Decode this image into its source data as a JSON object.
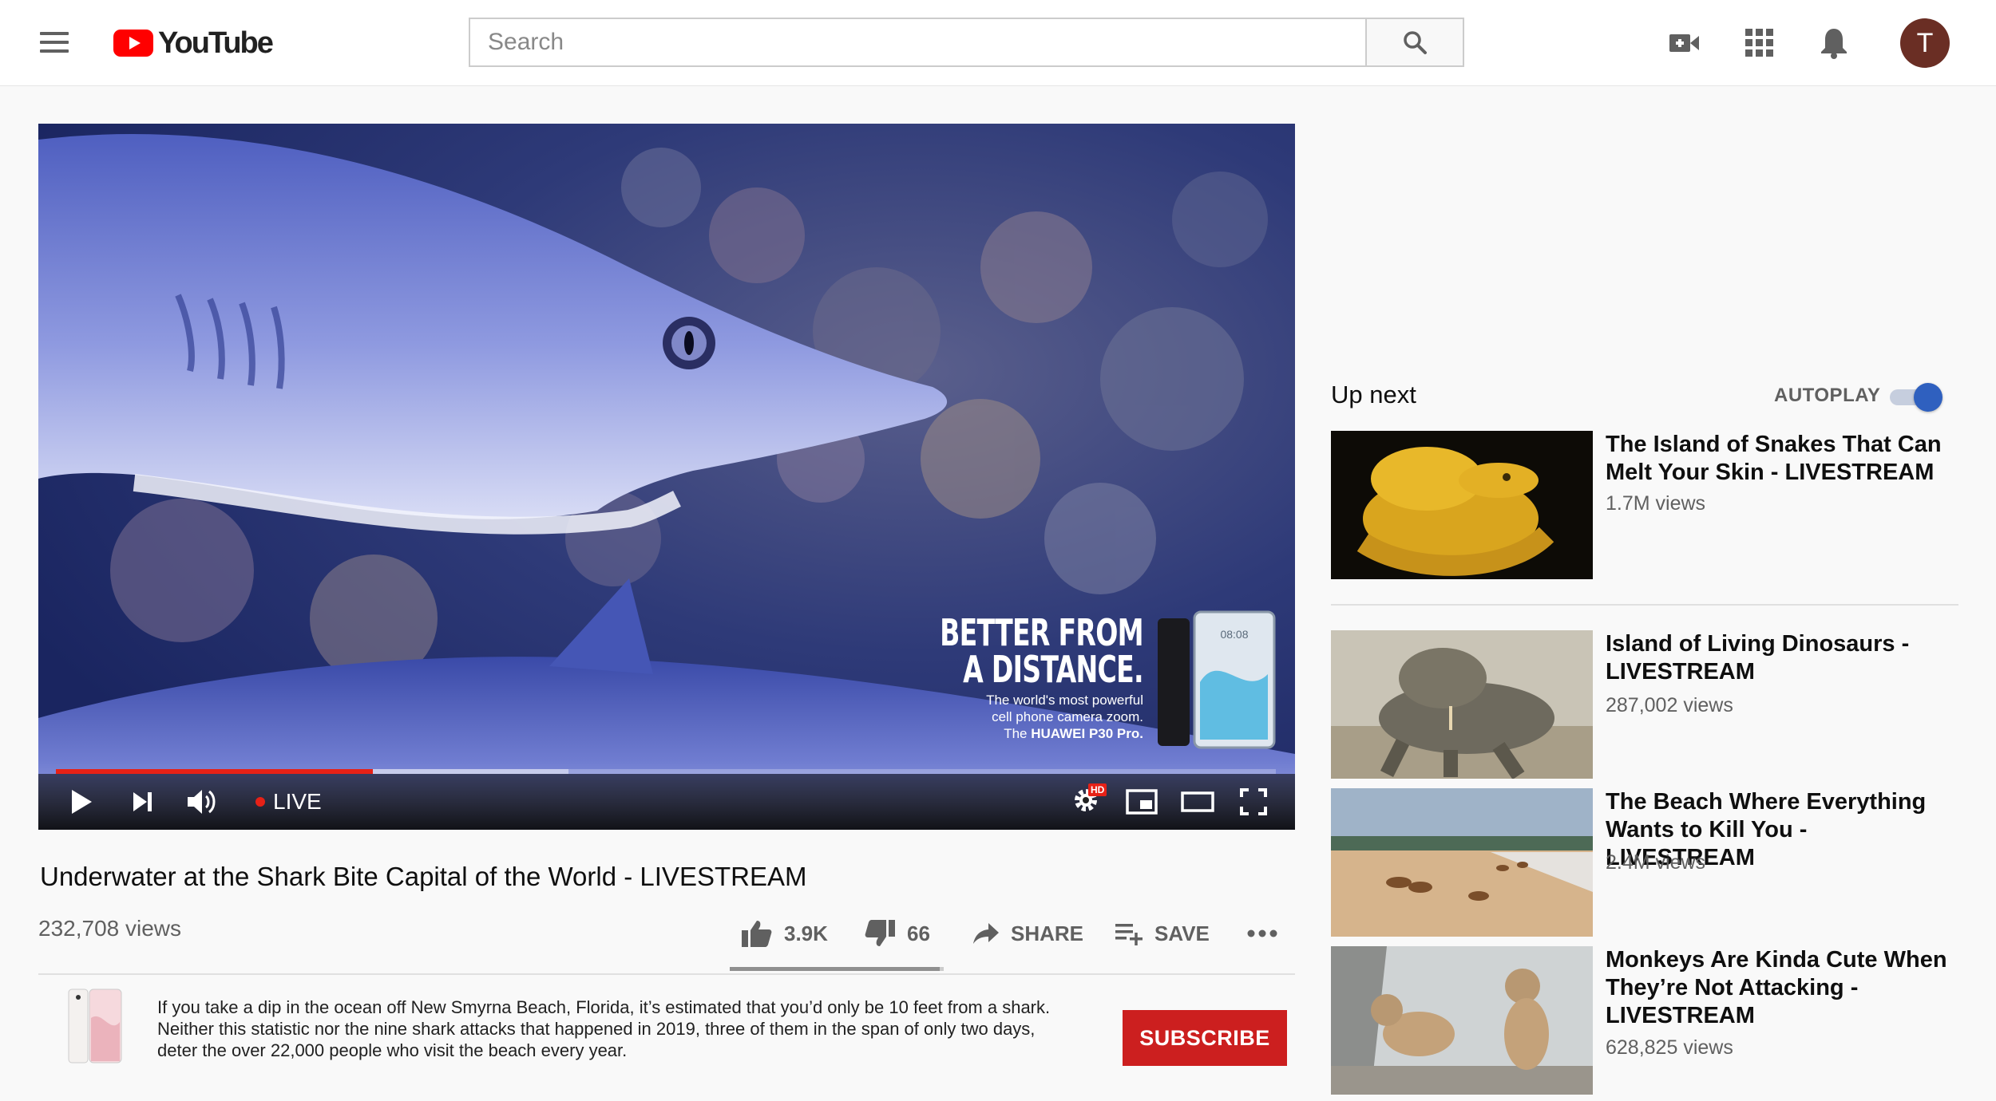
{
  "header": {
    "logo_text": "YouTube",
    "search_placeholder": "Search",
    "avatar_letter": "T",
    "brand_color": "#ff0000"
  },
  "player": {
    "live_label": "LIVE",
    "hd_label": "HD",
    "progress_played": 0.26,
    "progress_buffered": 0.42,
    "ad": {
      "headline_line1": "BETTER FROM",
      "headline_line2": "A DISTANCE.",
      "copy_line1": "The world's most powerful",
      "copy_line2": "cell phone camera zoom.",
      "copy_line3_prefix": "The ",
      "copy_line3_brand": "HUAWEI P30 Pro.",
      "phone_time": "08:08"
    }
  },
  "video": {
    "title": "Underwater at the Shark Bite Capital of the World - LIVESTREAM",
    "views": "232,708 views",
    "likes": "3.9K",
    "dislikes": "66",
    "share_label": "SHARE",
    "save_label": "SAVE",
    "like_ratio": 0.98
  },
  "ad_row": {
    "description": "If you take a dip in the ocean off New Smyrna Beach, Florida, it’s estimated that you’d only be 10 feet from a shark. Neither this statistic nor the nine shark attacks that happened in 2019, three of them in the span of only two days, deter the over 22,000 people who visit the beach every year.",
    "subscribe_label": "SUBSCRIBE",
    "subscribe_color": "#cc1f1f"
  },
  "sidebar": {
    "up_next_label": "Up next",
    "autoplay_label": "AUTOPLAY",
    "autoplay_on": true,
    "videos": [
      {
        "title": "The Island of Snakes That Can Melt Your Skin - LIVESTREAM",
        "views": "1.7M views"
      },
      {
        "title": "Island of Living Dinosaurs - LIVESTREAM",
        "views": "287,002 views"
      },
      {
        "title": "The Beach Where Everything Wants to Kill You - LIVESTREAM",
        "views": "2.4M views"
      },
      {
        "title": "Monkeys Are Kinda Cute When They’re Not Attacking - LIVESTREAM",
        "views": "628,825 views"
      }
    ]
  }
}
